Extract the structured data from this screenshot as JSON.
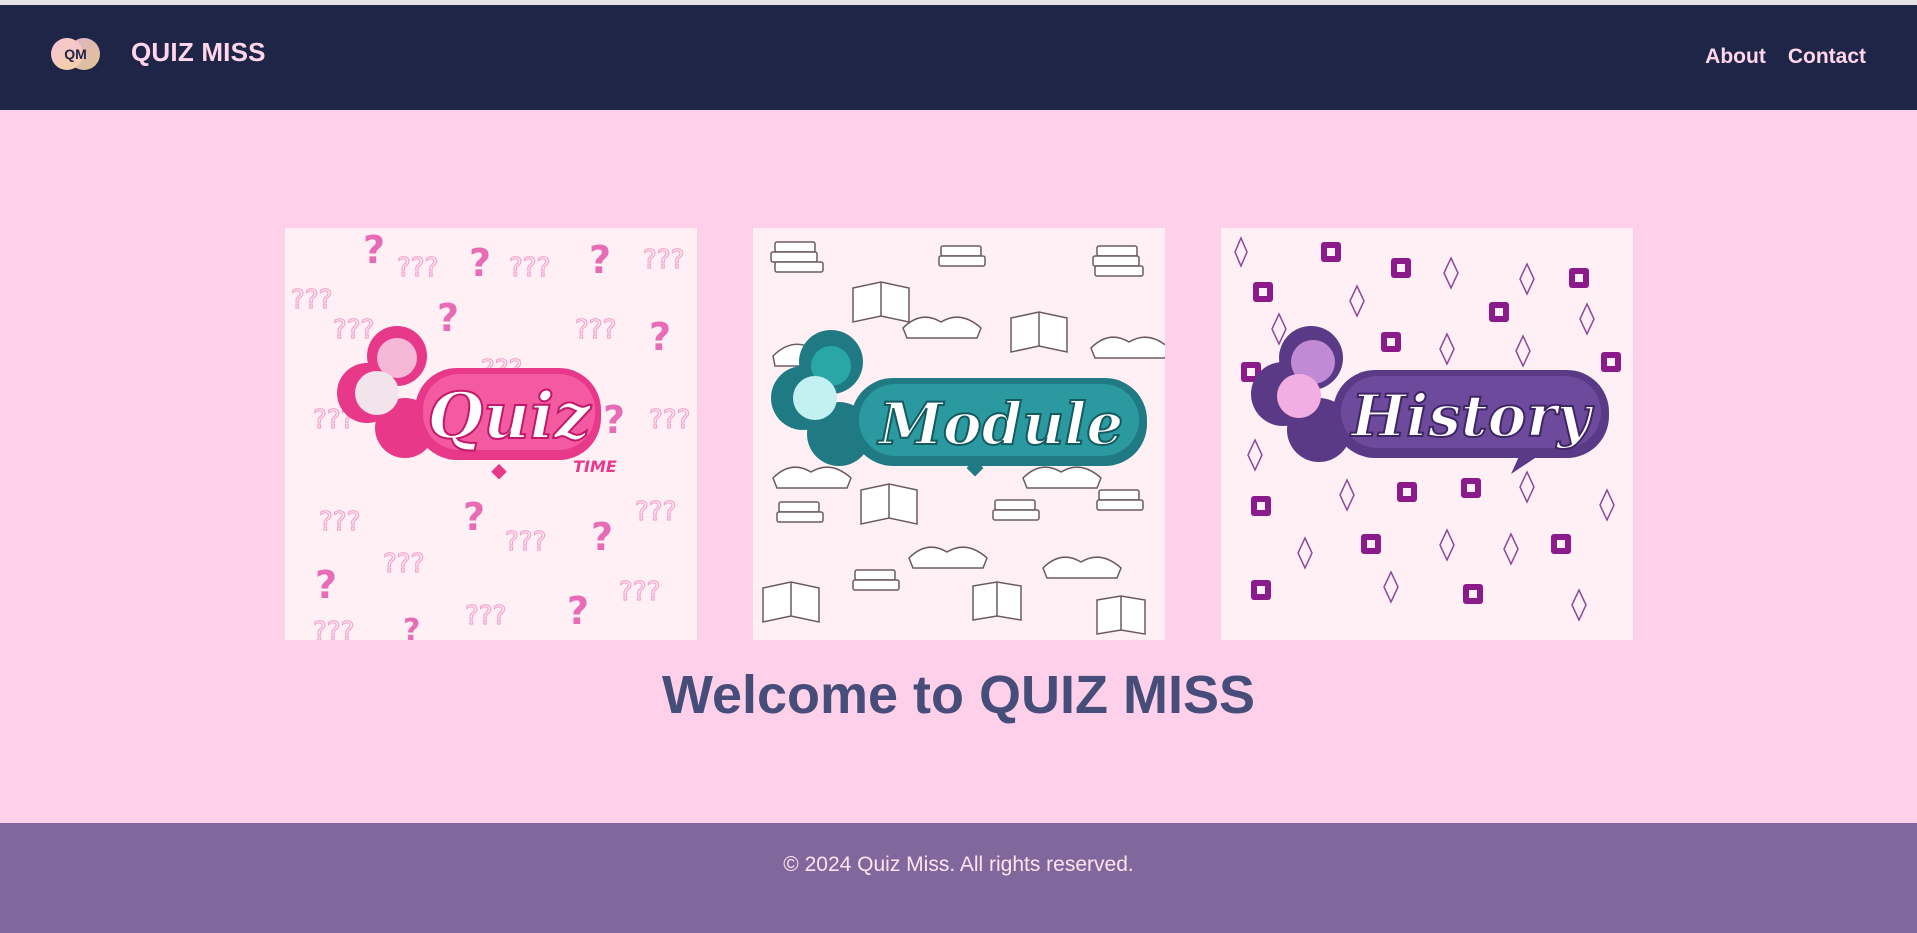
{
  "header": {
    "logo_text": "QM",
    "brand": "QUIZ MISS",
    "nav": [
      "About",
      "Contact"
    ]
  },
  "cards": [
    {
      "label": "Quiz",
      "sub": "TIME",
      "icon": "question-mark-pattern"
    },
    {
      "label": "Module",
      "icon": "book-pattern"
    },
    {
      "label": "History",
      "icon": "sparkle-pattern"
    }
  ],
  "main": {
    "welcome": "Welcome to QUIZ MISS"
  },
  "footer": {
    "copyright": "© 2024 Quiz Miss. All rights reserved."
  },
  "colors": {
    "navbar": "#1f2547",
    "page_bg": "#ffd0ea",
    "footer": "#81689c",
    "heading": "#454d78",
    "quiz_accent": "#e8388a",
    "module_accent": "#1f7a84",
    "history_accent": "#5a3a86"
  }
}
